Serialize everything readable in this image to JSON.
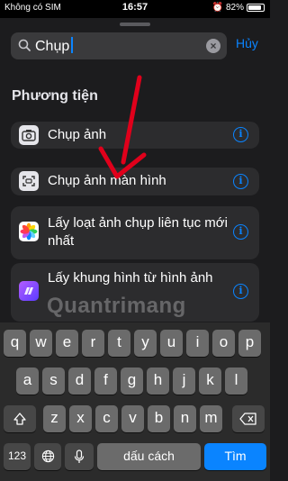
{
  "status": {
    "carrier": "Không có SIM",
    "time": "16:57",
    "battery": "82%"
  },
  "search": {
    "query": "Chụp",
    "cancel_label": "Hủy"
  },
  "section_title": "Phương tiện",
  "actions": [
    {
      "label": "Chụp ảnh",
      "icon": "camera-icon"
    },
    {
      "label": "Chụp ảnh màn hình",
      "icon": "screenshot-icon"
    },
    {
      "label": "Lấy loạt ảnh chụp liên tục mới nhất",
      "icon": "photos-icon"
    },
    {
      "label": "Lấy khung hình từ hình ảnh",
      "icon": "frames-icon"
    }
  ],
  "watermark": "Quantrimang",
  "keyboard": {
    "row1": [
      "q",
      "w",
      "e",
      "r",
      "t",
      "y",
      "u",
      "i",
      "o",
      "p"
    ],
    "row2": [
      "a",
      "s",
      "d",
      "f",
      "g",
      "h",
      "j",
      "k",
      "l"
    ],
    "row3": [
      "z",
      "x",
      "c",
      "v",
      "b",
      "n",
      "m"
    ],
    "num_label": "123",
    "space_label": "dấu cách",
    "go_label": "Tìm"
  },
  "colors": {
    "accent": "#0a84ff",
    "arrow": "#e0001b"
  }
}
